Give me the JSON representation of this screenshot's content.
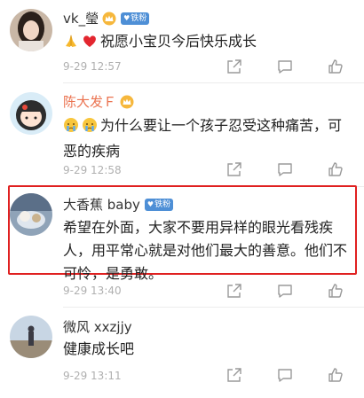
{
  "comments": [
    {
      "user": "vk_瑩",
      "badge": "铁粉",
      "emojis": [
        "folded-hands-icon",
        "red-heart-icon"
      ],
      "text": "祝愿小宝贝今后快乐成长",
      "time": "9-29 12:57"
    },
    {
      "user": "陈大发Ｆ",
      "emojis": [
        "crying-face-icon",
        "crying-face-icon"
      ],
      "text_line1": "为什么要让一个孩子忍受这种痛苦，可",
      "text_line2": "恶的疾病",
      "time": "9-29 12:58"
    },
    {
      "user": "大香蕉 baby",
      "badge": "铁粉",
      "text_line1": "希望在外面，大家不要用异样的眼光看残疾",
      "text_line2": "人，用平常心就是对他们最大的善意。他们不",
      "text_line3": "可怜，是勇敢。",
      "time": "9-29 13:40"
    },
    {
      "user": "微风 xxzjjy",
      "text": "健康成长吧",
      "time": "9-29 13:11"
    }
  ],
  "colors": {
    "vip_name": "#eb7350",
    "fan_badge": "#4e8fd6",
    "highlight_border": "#e02020"
  }
}
